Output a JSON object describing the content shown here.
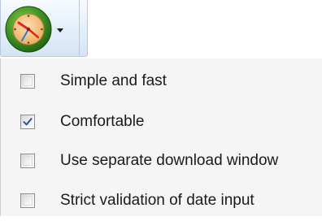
{
  "toolbar": {
    "button_icon": "clock-icon",
    "dropdown_icon": "chevron-down-icon"
  },
  "menu": {
    "items": [
      {
        "label": "Simple and fast",
        "checked": false
      },
      {
        "label": "Comfortable",
        "checked": true
      },
      {
        "label": "Use separate download window",
        "checked": false
      },
      {
        "label": "Strict validation of date input",
        "checked": false
      }
    ]
  },
  "colors": {
    "clock_ring": "#2f7d1c",
    "clock_face": "#f4c27a",
    "hand_red": "#e0281d",
    "hand_blue": "#2a7fd6",
    "checkmark": "#2b50a8"
  }
}
